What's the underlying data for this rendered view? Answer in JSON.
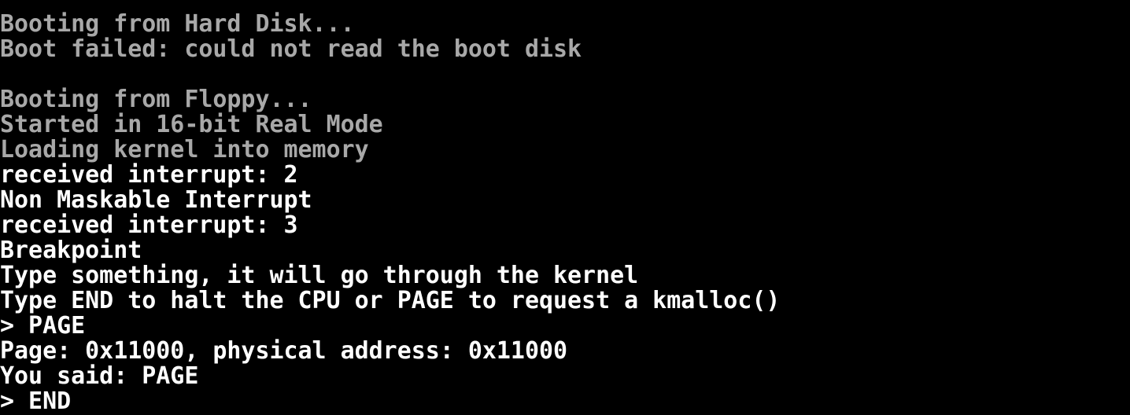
{
  "colors": {
    "background": "#000000",
    "dim_text": "#a8a8a8",
    "bright_text": "#ffffff"
  },
  "console": {
    "lines": [
      {
        "text": "Booting from Hard Disk...",
        "tone": "gray"
      },
      {
        "text": "Boot failed: could not read the boot disk",
        "tone": "gray"
      },
      {
        "text": "",
        "tone": "gray"
      },
      {
        "text": "Booting from Floppy...",
        "tone": "gray"
      },
      {
        "text": "Started in 16-bit Real Mode",
        "tone": "gray"
      },
      {
        "text": "Loading kernel into memory",
        "tone": "gray"
      },
      {
        "text": "received interrupt: 2",
        "tone": "white"
      },
      {
        "text": "Non Maskable Interrupt",
        "tone": "white"
      },
      {
        "text": "received interrupt: 3",
        "tone": "white"
      },
      {
        "text": "Breakpoint",
        "tone": "white"
      },
      {
        "text": "Type something, it will go through the kernel",
        "tone": "white"
      },
      {
        "text": "Type END to halt the CPU or PAGE to request a kmalloc()",
        "tone": "white"
      },
      {
        "text": "> PAGE",
        "tone": "white"
      },
      {
        "text": "Page: 0x11000, physical address: 0x11000",
        "tone": "white"
      },
      {
        "text": "You said: PAGE",
        "tone": "white"
      },
      {
        "text": "> END",
        "tone": "white"
      }
    ]
  }
}
